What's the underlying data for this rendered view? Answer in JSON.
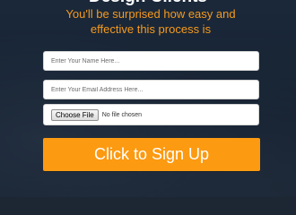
{
  "form": {
    "headline": "Design Clients",
    "subline": "You'll be surprised how easy and effective this process is",
    "name_placeholder": "Enter Your Name Here...",
    "email_placeholder": "Enter Your Email Address Here...",
    "file_button_label": "Choose File",
    "file_status": "No file chosen",
    "submit_label": "Click to Sign Up"
  },
  "colors": {
    "accent": "#fc9a11",
    "subline": "#f79a1c",
    "background": "#1c2733"
  }
}
